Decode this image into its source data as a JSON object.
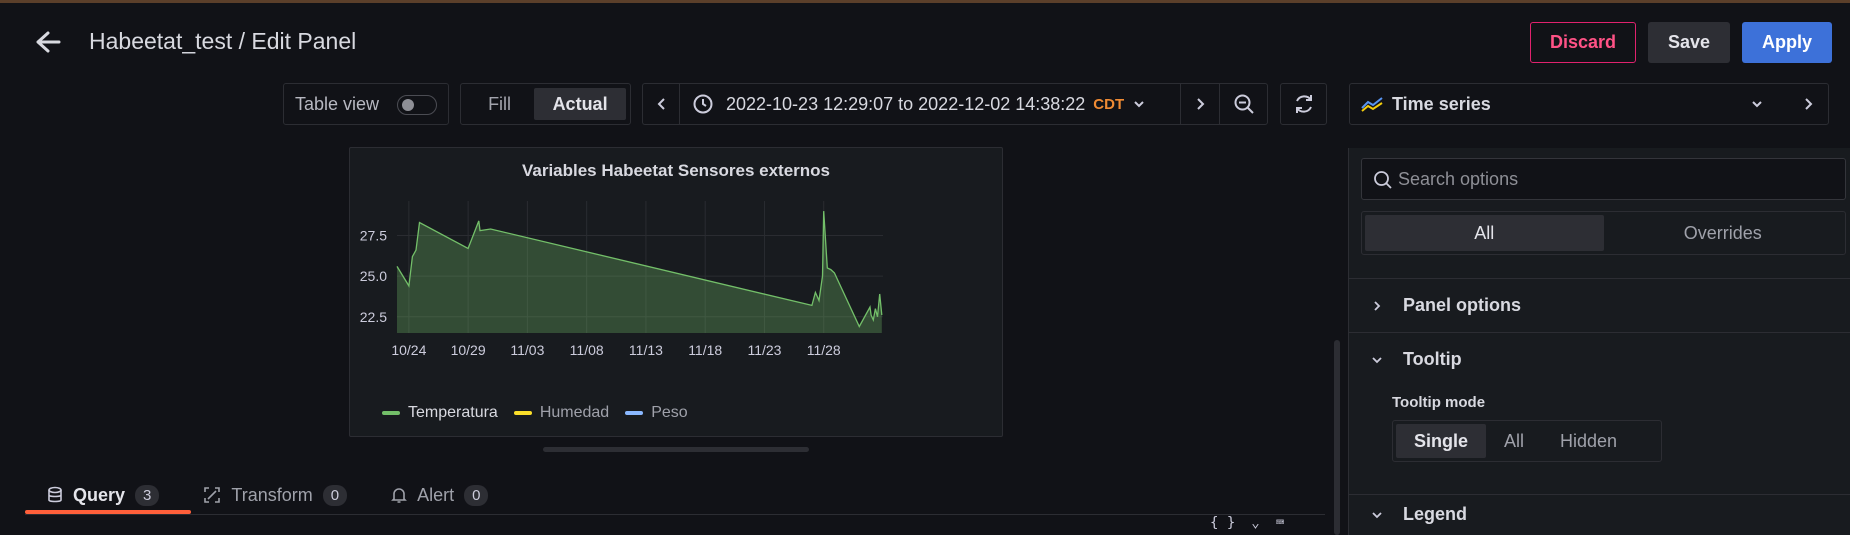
{
  "header": {
    "title": "Habeetat_test / Edit Panel",
    "discard_label": "Discard",
    "save_label": "Save",
    "apply_label": "Apply"
  },
  "toolbar": {
    "table_view_label": "Table view",
    "table_view_on": false,
    "fill_label": "Fill",
    "actual_label": "Actual",
    "time_range": "2022-10-23 12:29:07 to 2022-12-02 14:38:22",
    "timezone": "CDT"
  },
  "panel": {
    "title": "Variables Habeetat Sensores externos",
    "legend": [
      {
        "name": "Temperatura",
        "color": "#73bf69"
      },
      {
        "name": "Humedad",
        "color": "#fade2a"
      },
      {
        "name": "Peso",
        "color": "#8ab8ff"
      }
    ]
  },
  "chart_data": {
    "type": "area",
    "title": "Variables Habeetat Sensores externos",
    "xlabel": "",
    "ylabel": "",
    "x_ticks": [
      "10/24",
      "10/29",
      "11/03",
      "11/08",
      "11/13",
      "11/18",
      "11/23",
      "11/28"
    ],
    "y_ticks": [
      22.5,
      25.0,
      27.5
    ],
    "xlim": [
      "2022-10-23",
      "2022-12-03"
    ],
    "ylim": [
      21.5,
      29.5
    ],
    "grid": true,
    "series": [
      {
        "name": "Temperatura",
        "color": "#73bf69",
        "x": [
          "2022-10-23",
          "2022-10-24",
          "2022-10-24",
          "2022-10-24",
          "2022-10-24",
          "2022-10-29",
          "2022-10-29",
          "2022-10-30",
          "2022-10-30",
          "2022-11-27",
          "2022-11-27",
          "2022-11-27",
          "2022-11-27",
          "2022-11-28",
          "2022-11-28",
          "2022-11-28",
          "2022-11-28",
          "2022-12-01",
          "2022-12-01",
          "2022-12-02",
          "2022-12-02",
          "2022-12-02",
          "2022-12-02",
          "2022-12-02",
          "2022-12-02"
        ],
        "y": [
          25.6,
          24.4,
          26.2,
          26.6,
          28.3,
          26.7,
          28.4,
          27.8,
          27.9,
          23.2,
          24.0,
          23.5,
          25.0,
          29.0,
          25.5,
          25.4,
          25.2,
          21.9,
          23.1,
          22.6,
          22.3,
          23.0,
          22.5,
          23.9,
          22.6
        ]
      },
      {
        "name": "Humedad",
        "color": "#fade2a",
        "x": [],
        "y": []
      },
      {
        "name": "Peso",
        "color": "#8ab8ff",
        "x": [],
        "y": []
      }
    ]
  },
  "tabs": [
    {
      "label": "Query",
      "count": "3"
    },
    {
      "label": "Transform",
      "count": "0"
    },
    {
      "label": "Alert",
      "count": "0"
    }
  ],
  "query_icons": {
    "json": "{ }",
    "chevron": "⌄",
    "keyboard": "⌨"
  },
  "options": {
    "visualization": "Time series",
    "search_placeholder": "Search options",
    "tab_all": "All",
    "tab_overrides": "Overrides",
    "section_panel": "Panel options",
    "section_tooltip": "Tooltip",
    "tooltip_mode_label": "Tooltip mode",
    "tooltip_modes": [
      "Single",
      "All",
      "Hidden"
    ],
    "tooltip_mode_selected": "Single",
    "section_legend": "Legend"
  }
}
